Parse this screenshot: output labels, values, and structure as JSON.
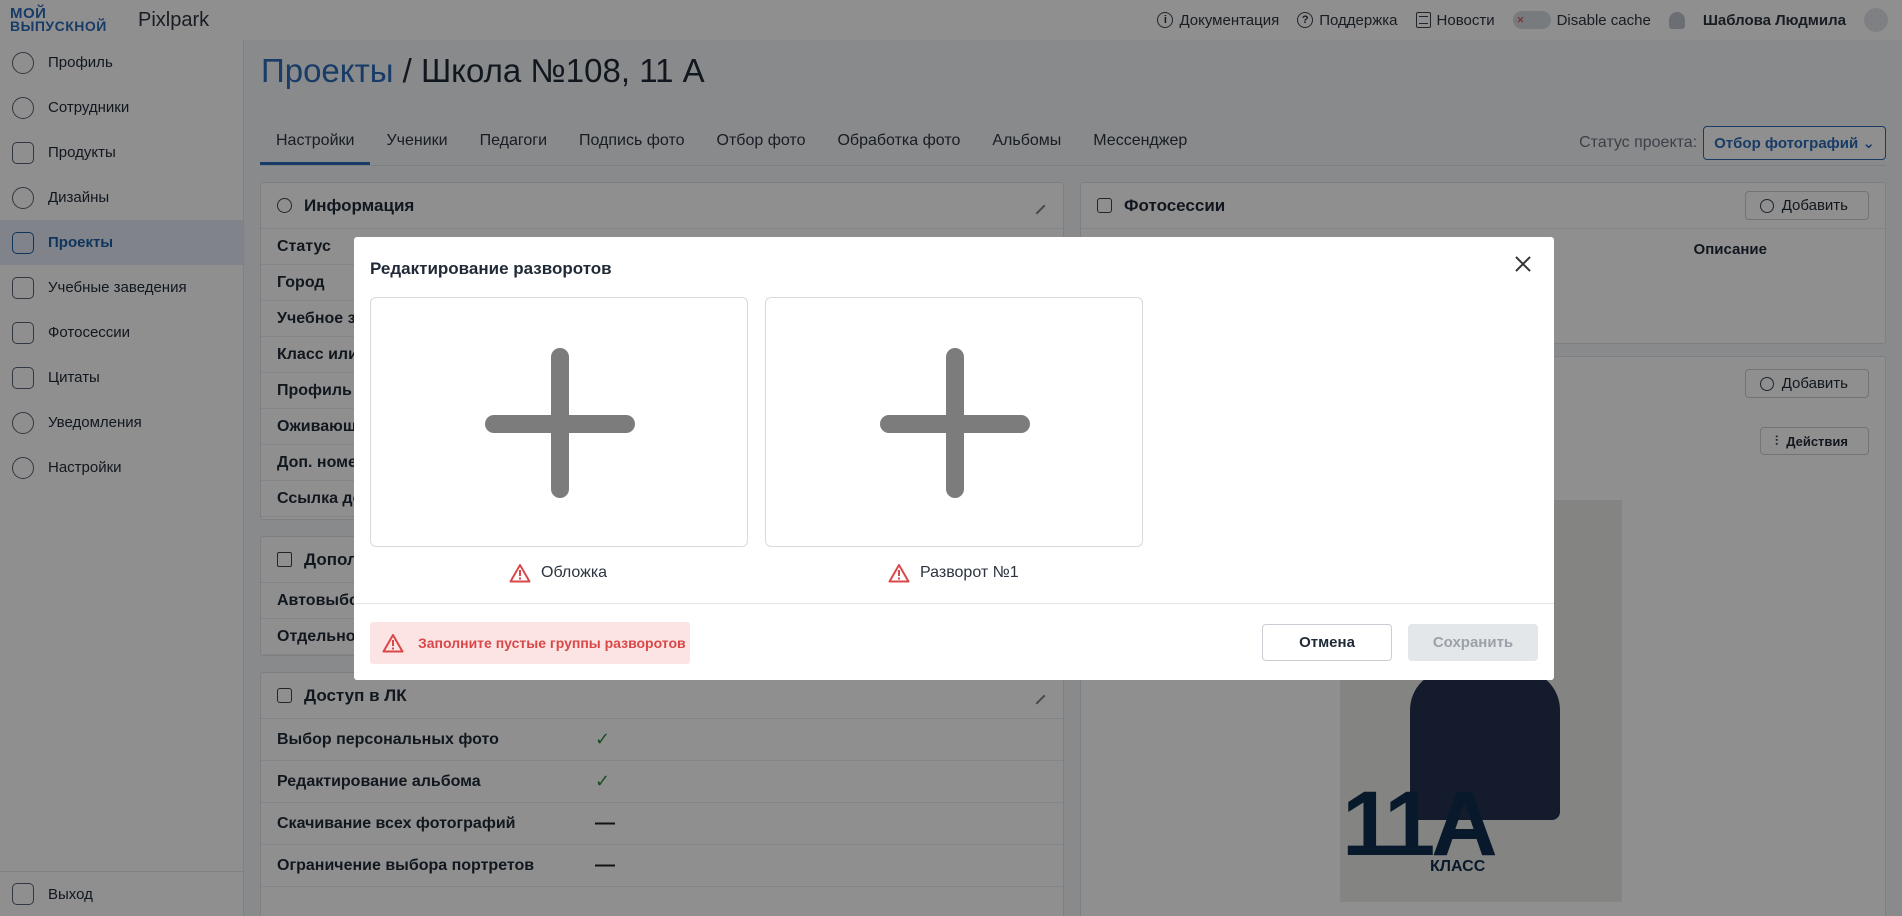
{
  "topbar": {
    "logo_line1": "МОЙ",
    "logo_line2": "ВЫПУСКНОЙ",
    "brand": "Pixlpark",
    "docs": "Документация",
    "support": "Поддержка",
    "news": "Новости",
    "disable_cache": "Disable cache",
    "user": "Шаблова Людмила"
  },
  "sidebar": {
    "items": [
      {
        "label": "Профиль",
        "icon": "user-icon"
      },
      {
        "label": "Сотрудники",
        "icon": "staff-icon"
      },
      {
        "label": "Продукты",
        "icon": "book-icon"
      },
      {
        "label": "Дизайны",
        "icon": "palette-icon"
      },
      {
        "label": "Проекты",
        "icon": "briefcase-icon"
      },
      {
        "label": "Учебные заведения",
        "icon": "building-icon"
      },
      {
        "label": "Фотосессии",
        "icon": "camera-icon"
      },
      {
        "label": "Цитаты",
        "icon": "list-icon"
      },
      {
        "label": "Уведомления",
        "icon": "bell-icon"
      },
      {
        "label": "Настройки",
        "icon": "gear-icon"
      }
    ],
    "exit": "Выход"
  },
  "page": {
    "breadcrumb": "Проекты",
    "separator": " / ",
    "title": "Школа №108, 11 А",
    "tabs": [
      "Настройки",
      "Ученики",
      "Педагоги",
      "Подпись фото",
      "Отбор фото",
      "Обработка фото",
      "Альбомы",
      "Мессенджер"
    ],
    "status_label": "Статус проекта:",
    "status_value": "Отбор фотографий"
  },
  "info_card": {
    "title": "Информация",
    "rows": [
      "Статус",
      "Город",
      "Учебное з",
      "Класс или",
      "Профиль",
      "Оживающ",
      "Доп. номе",
      "Ссылка до"
    ]
  },
  "extra_card": {
    "title": "Допол",
    "rows": [
      "Автовыбо",
      "Отдельно"
    ]
  },
  "access_card": {
    "title": "Доступ в ЛК",
    "rows": [
      {
        "label": "Выбор персональных фото",
        "value": "✓"
      },
      {
        "label": "Редактирование альбома",
        "value": "✓"
      },
      {
        "label": "Скачивание всех фотографий",
        "value": "—"
      },
      {
        "label": "Ограничение выбора портретов",
        "value": "—"
      }
    ]
  },
  "photosessions": {
    "title": "Фотосессии",
    "add": "Добавить",
    "col_description": "Описание",
    "add2": "Добавить",
    "actions": "Действия"
  },
  "poster": {
    "big": "11А",
    "cls": "КЛАСС"
  },
  "modal": {
    "title": "Редактирование разворотов",
    "spreads": [
      {
        "label": "Обложка"
      },
      {
        "label": "Разворот №1"
      }
    ],
    "alert": "Заполните пустые группы разворотов",
    "cancel": "Отмена",
    "save": "Сохранить"
  },
  "colors": {
    "accent": "#2b6cb8",
    "error": "#d94848",
    "error_bg": "#fde4e4",
    "success": "#2e8a3e"
  }
}
